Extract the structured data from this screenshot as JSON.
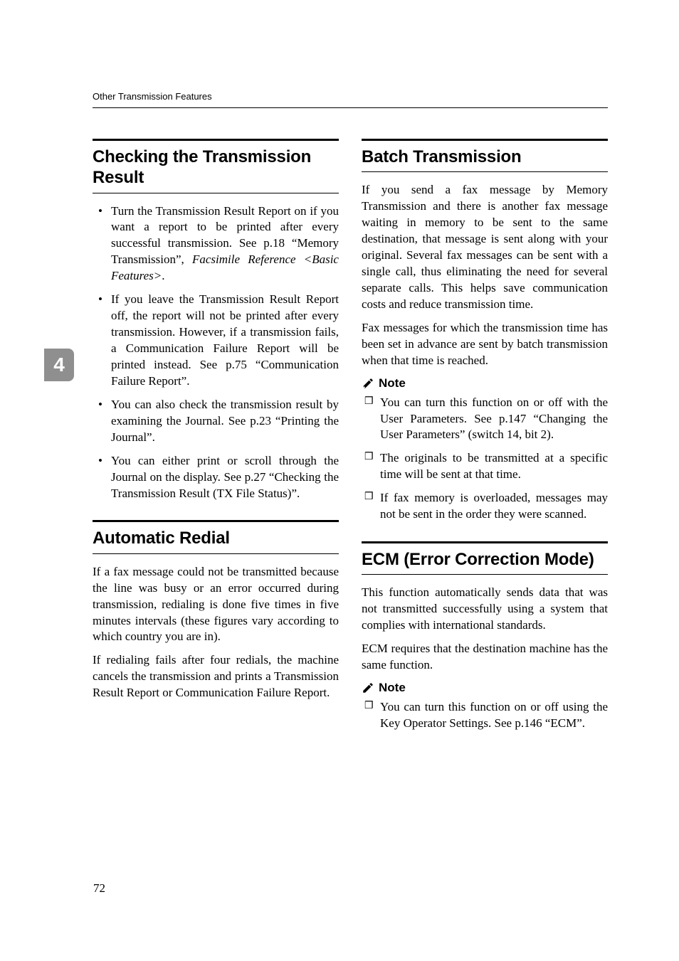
{
  "running_header": "Other Transmission Features",
  "chapter_number": "4",
  "page_number": "72",
  "left_column": {
    "section1": {
      "title": "Checking the Transmission Result",
      "bullets": [
        "Turn the Transmission Result Report on if you want a report to be printed after every successful transmission. See p.18 “Memory Transmission”, ",
        "If you leave the Transmission Result Report off, the report will not be printed after every transmission. However, if a transmission fails, a Communication Failure Report will be printed instead. See p.75 “Communication Failure Report”.",
        "You can also check the transmission result by examining the Journal. See p.23 “Printing the Journal”.",
        "You can either print or scroll through the Journal on the display. See p.27 “Checking the Transmission Result (TX File Status)”."
      ],
      "bullet0_italic": "Facsimile Reference <Basic Features>",
      "bullet0_tail": "."
    },
    "section2": {
      "title": "Automatic Redial",
      "paragraphs": [
        "If a fax message could not be transmitted because the line was busy or an error occurred during transmission, redialing is done five times in five minutes intervals (these figures vary according to which country you are in).",
        "If redialing fails after four redials, the machine cancels the transmission and prints a Transmission Result Report or Communication Failure Report."
      ]
    }
  },
  "right_column": {
    "section1": {
      "title": "Batch Transmission",
      "paragraphs": [
        "If you send a fax message by Memory Transmission and there is another fax message waiting in memory to be sent to the same destination, that message is sent along with your original. Several fax messages can be sent with a single call, thus eliminating the need for several separate calls. This helps save communication costs and reduce transmission time.",
        "Fax messages for which the transmission time has been set in advance are sent by batch transmission when that time is reached."
      ],
      "note_label": "Note",
      "notes": [
        "You can turn this function on or off with the User Parameters. See p.147 “Changing the User Parameters” (switch 14, bit 2).",
        "The originals to be transmitted at a specific time will be sent at that time.",
        "If fax memory is overloaded, messages may not be sent in the order they were scanned."
      ]
    },
    "section2": {
      "title": "ECM (Error Correction Mode)",
      "paragraphs": [
        "This function automatically sends data that was not transmitted successfully using a system that complies with international standards.",
        "ECM requires that the destination machine has the same function."
      ],
      "note_label": "Note",
      "notes": [
        "You can turn this function on or off using the Key Operator Settings. See p.146 “ECM”."
      ]
    }
  }
}
